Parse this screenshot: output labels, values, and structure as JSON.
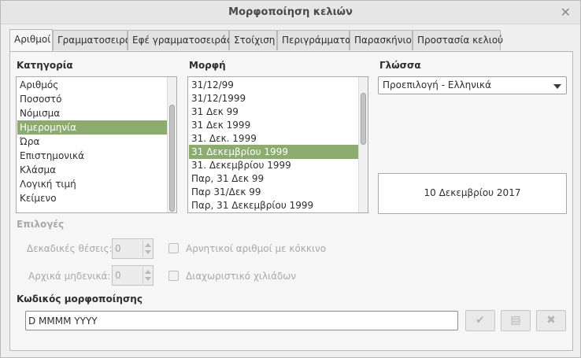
{
  "window": {
    "title": "Μορφοποίηση κελιών",
    "close_glyph": "✕"
  },
  "tabs": [
    {
      "label": "Αριθμοί"
    },
    {
      "label": "Γραμματοσειρά"
    },
    {
      "label": "Εφέ γραμματοσειράς"
    },
    {
      "label": "Στοίχιση"
    },
    {
      "label": "Περιγράμματα"
    },
    {
      "label": "Παρασκήνιο"
    },
    {
      "label": "Προστασία κελιού"
    }
  ],
  "active_tab": "Αριθμοί",
  "category": {
    "label": "Κατηγορία",
    "items": [
      "Αριθμός",
      "Ποσοστό",
      "Νόμισμα",
      "Ημερομηνία",
      "Ώρα",
      "Επιστημονικά",
      "Κλάσμα",
      "Λογική τιμή",
      "Κείμενο"
    ],
    "selected": "Ημερομηνία"
  },
  "format": {
    "label": "Μορφή",
    "items": [
      "31/12/99",
      "31/12/1999",
      "31 Δεκ 99",
      "31 Δεκ 1999",
      "31. Δεκ. 1999",
      "31 Δεκεμβρίου 1999",
      "31. Δεκεμβρίου 1999",
      "Παρ, 31 Δεκ 99",
      "Παρ 31/Δεκ 99",
      "Παρ, 31 Δεκεμβρίου 1999"
    ],
    "selected": "31 Δεκεμβρίου 1999"
  },
  "language": {
    "label": "Γλώσσα",
    "selected": "Προεπιλογή - Ελληνικά"
  },
  "preview": {
    "text": "10 Δεκεμβρίου 2017"
  },
  "options": {
    "label": "Επιλογές",
    "decimal_places_label": "Δεκαδικές θέσεις:",
    "decimal_places_value": "0",
    "leading_zeros_label": "Αρχικά μηδενικά:",
    "leading_zeros_value": "0",
    "negative_red_label": "Αρνητικοί αριθμοί με κόκκινο",
    "thousands_sep_label": "Διαχωριστικό χιλιάδων"
  },
  "format_code": {
    "label": "Κωδικός μορφοποίησης",
    "value": "D MMMM YYYY"
  },
  "icons": {
    "apply": "check-icon",
    "comment": "comment-icon",
    "delete": "delete-icon"
  },
  "colors": {
    "selection": "#8bab6f"
  }
}
